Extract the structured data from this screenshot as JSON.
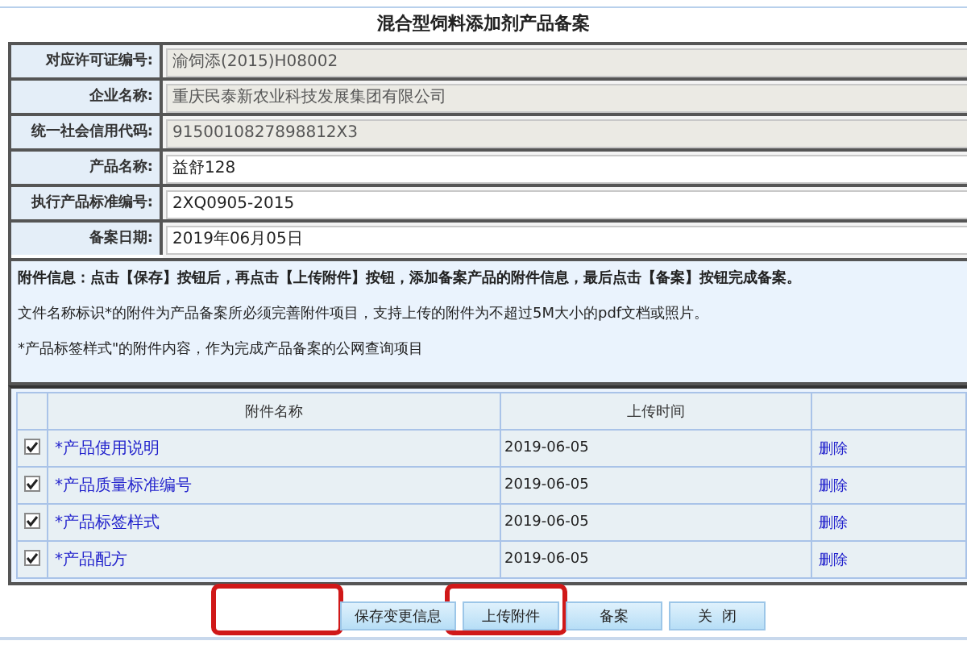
{
  "title": "混合型饲料添加剂产品备案",
  "fields": [
    {
      "label": "对应许可证编号:",
      "value": "渝饲添(2015)H08002",
      "disabled": true
    },
    {
      "label": "企业名称:",
      "value": "重庆民泰新农业科技发展集团有限公司",
      "disabled": true
    },
    {
      "label": "统一社会信用代码:",
      "value": "9150010827898812X3",
      "disabled": true
    },
    {
      "label": "产品名称:",
      "value": "益舒128",
      "disabled": false
    },
    {
      "label": "执行产品标准编号:",
      "value": "2XQ0905-2015",
      "disabled": false
    },
    {
      "label": "备案日期:",
      "value": "2019年06月05日",
      "disabled": false
    }
  ],
  "info": {
    "heading": "附件信息：点击【保存】按钮后，再点击【上传附件】按钮，添加备案产品的附件信息，最后点击【备案】按钮完成备案。",
    "lines": [
      "文件名称标识*的附件为产品备案所必须完善附件项目，支持上传的附件为不超过5M大小的pdf文档或照片。",
      "*产品标签样式\"的附件内容，作为完成产品备案的公网查询项目"
    ]
  },
  "attachments": {
    "columns": [
      "附件名称",
      "上传时间"
    ],
    "rows": [
      {
        "checked": true,
        "name": "*产品使用说明",
        "time": "2019-06-05",
        "action": "删除"
      },
      {
        "checked": true,
        "name": "*产品质量标准编号",
        "time": "2019-06-05",
        "action": "删除"
      },
      {
        "checked": true,
        "name": "*产品标签样式",
        "time": "2019-06-05",
        "action": "删除"
      },
      {
        "checked": true,
        "name": "*产品配方",
        "time": "2019-06-05",
        "action": "删除"
      }
    ]
  },
  "buttons": [
    "保存变更信息",
    "上传附件",
    "备案",
    "关  闭"
  ]
}
